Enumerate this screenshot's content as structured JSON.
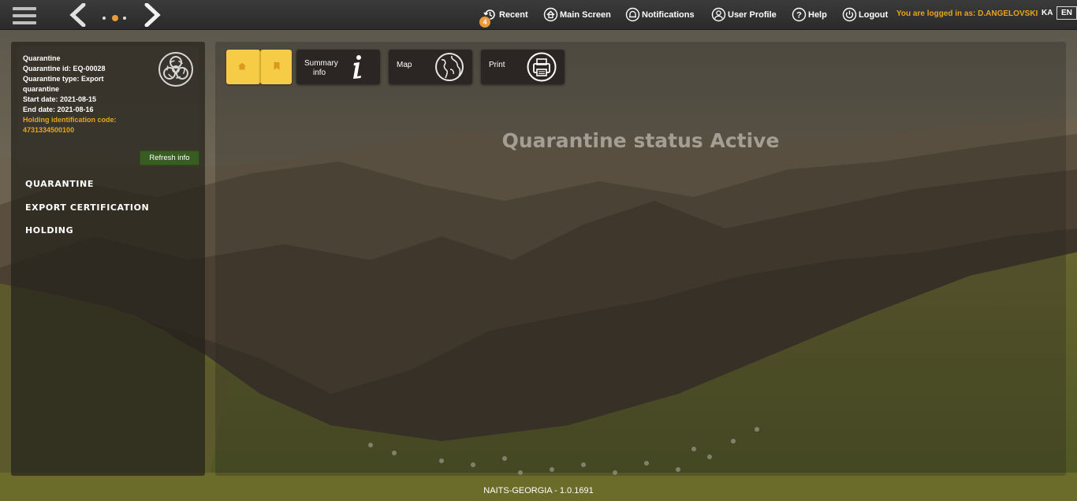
{
  "topbar": {
    "menu": [
      {
        "id": "recent",
        "label": "Recent",
        "icon": "recent-icon",
        "badge": "4"
      },
      {
        "id": "main",
        "label": "Main Screen",
        "icon": "home-icon"
      },
      {
        "id": "notifications",
        "label": "Notifications",
        "icon": "bell-icon"
      },
      {
        "id": "profile",
        "label": "User Profile",
        "icon": "user-icon"
      },
      {
        "id": "help",
        "label": "Help",
        "icon": "help-icon"
      },
      {
        "id": "logout",
        "label": "Logout",
        "icon": "power-icon"
      }
    ],
    "logged_in_text": "You are logged in as: D.ANGELOVSKI",
    "languages": [
      "KA",
      "EN"
    ],
    "active_language": "EN"
  },
  "quarantine_info": {
    "title": "Quarantine",
    "id_line": "Quarantine id: EQ-00028",
    "type_line_1": "Quarantine type: Export",
    "type_line_2": "quarantine",
    "start_line": "Start date: 2021-08-15",
    "end_line": "End date: 2021-08-16",
    "holding_label": "Holding identification code:",
    "holding_code": "4731334500100",
    "refresh_label": "Refresh info",
    "icon": "biohazard-icon"
  },
  "side_nav": {
    "items": [
      {
        "label": "QUARANTINE"
      },
      {
        "label": "EXPORT CERTIFICATION"
      },
      {
        "label": "HOLDING"
      }
    ]
  },
  "toolbar": {
    "summary_line1": "Summary",
    "summary_line2": "info",
    "map_label": "Map",
    "print_label": "Print"
  },
  "main": {
    "status_title": "Quarantine status Active"
  },
  "footer": {
    "version": "NAITS-GEORGIA - 1.0.1691"
  },
  "colors": {
    "accent_orange": "#e8a51c",
    "tile_yellow": "#f6cb45",
    "refresh_green": "#385c22"
  }
}
